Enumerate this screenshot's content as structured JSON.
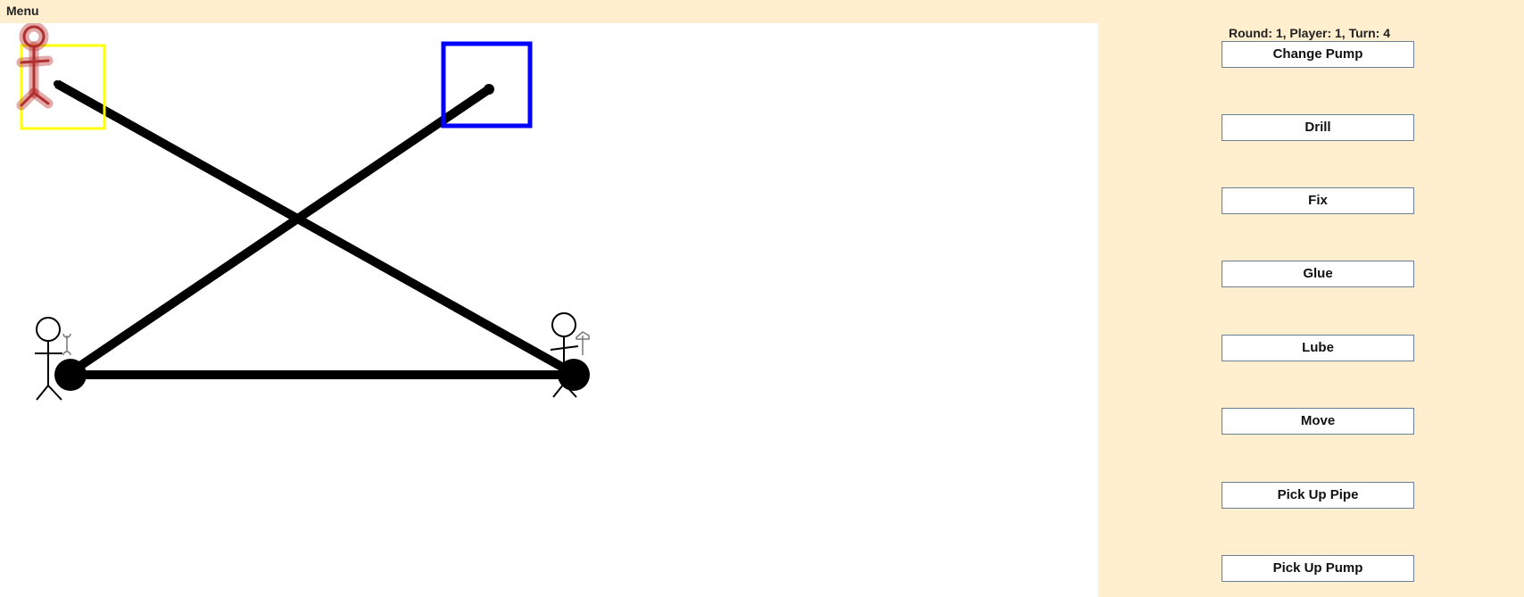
{
  "menubar": {
    "menu_label": "Menu"
  },
  "status": {
    "text": "Round: 1, Player: 1, Turn: 4"
  },
  "actions": [
    {
      "label": "Change Pump"
    },
    {
      "label": "Drill"
    },
    {
      "label": "Fix"
    },
    {
      "label": "Glue"
    },
    {
      "label": "Lube"
    },
    {
      "label": "Move"
    },
    {
      "label": "Pick Up Pipe"
    },
    {
      "label": "Pick Up Pump"
    }
  ],
  "board": {
    "selection_colors": {
      "player_highlight": "#ffff00",
      "target_highlight": "#0000ff",
      "active_player": "#b03030"
    },
    "icons": [
      "active-player-icon",
      "player-with-wrench-icon",
      "player-with-hammer-icon"
    ]
  }
}
